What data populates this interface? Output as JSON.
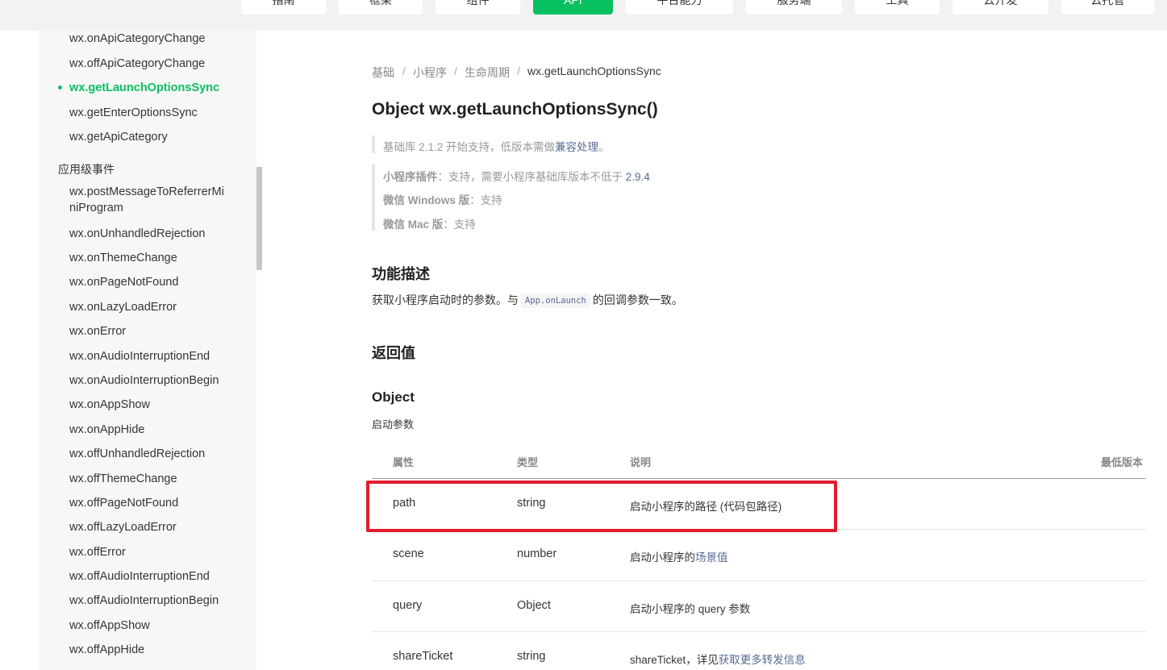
{
  "top_nav": {
    "tabs": [
      {
        "label": "指南",
        "active": false
      },
      {
        "label": "框架",
        "active": false
      },
      {
        "label": "组件",
        "active": false
      },
      {
        "label": "API",
        "active": true
      },
      {
        "label": "平台能力",
        "active": false
      },
      {
        "label": "服务端",
        "active": false
      },
      {
        "label": "工具",
        "active": false
      },
      {
        "label": "云开发",
        "active": false
      },
      {
        "label": "云托管",
        "active": false
      }
    ]
  },
  "sidebar": {
    "items_top": [
      {
        "label": "wx.onApiCategoryChange",
        "active": false
      },
      {
        "label": "wx.offApiCategoryChange",
        "active": false
      },
      {
        "label": "wx.getLaunchOptionsSync",
        "active": true
      },
      {
        "label": "wx.getEnterOptionsSync",
        "active": false
      },
      {
        "label": "wx.getApiCategory",
        "active": false
      }
    ],
    "group_title": "应用级事件",
    "group_items": [
      {
        "label_line1": "wx.postMessageToReferrerMi",
        "label_line2": "niProgram"
      },
      {
        "label": "wx.onUnhandledRejection"
      },
      {
        "label": "wx.onThemeChange"
      },
      {
        "label": "wx.onPageNotFound"
      },
      {
        "label": "wx.onLazyLoadError"
      },
      {
        "label": "wx.onError"
      },
      {
        "label": "wx.onAudioInterruptionEnd"
      },
      {
        "label": "wx.onAudioInterruptionBegin"
      },
      {
        "label": "wx.onAppShow"
      },
      {
        "label": "wx.onAppHide"
      },
      {
        "label": "wx.offUnhandledRejection"
      },
      {
        "label": "wx.offThemeChange"
      },
      {
        "label": "wx.offPageNotFound"
      },
      {
        "label": "wx.offLazyLoadError"
      },
      {
        "label": "wx.offError"
      },
      {
        "label": "wx.offAudioInterruptionEnd"
      },
      {
        "label": "wx.offAudioInterruptionBegin"
      },
      {
        "label": "wx.offAppShow"
      },
      {
        "label": "wx.offAppHide"
      }
    ]
  },
  "breadcrumb": {
    "items": [
      "基础",
      "小程序",
      "生命周期"
    ],
    "current": "wx.getLaunchOptionsSync",
    "separator": "/"
  },
  "page_title": "Object wx.getLaunchOptionsSync()",
  "support_note": {
    "prefix": "基础库 2.1.2 开始支持，低版本需做",
    "link": "兼容处理",
    "suffix": "。"
  },
  "compat": {
    "plugin_label": "小程序插件",
    "plugin_text": "：支持，需要小程序基础库版本不低于 ",
    "plugin_version": "2.9.4",
    "windows_label": "微信 Windows 版",
    "windows_text": "：支持",
    "mac_label": "微信 Mac 版",
    "mac_text": "：支持"
  },
  "section_desc": {
    "heading": "功能描述",
    "text_before": "获取小程序启动时的参数。与",
    "code": "App.onLaunch",
    "text_after": "的回调参数一致。"
  },
  "section_return": {
    "heading": "返回值",
    "object_heading": "Object",
    "object_desc": "启动参数"
  },
  "table": {
    "headers": {
      "prop": "属性",
      "type": "类型",
      "desc": "说明",
      "min_version": "最低版本"
    },
    "rows": [
      {
        "prop": "path",
        "type": "string",
        "desc": "启动小程序的路径 (代码包路径)",
        "highlighted": true
      },
      {
        "prop": "scene",
        "type": "number",
        "desc_text": "启动小程序的",
        "desc_link": "场景值"
      },
      {
        "prop": "query",
        "type": "Object",
        "desc": "启动小程序的 query 参数"
      },
      {
        "prop": "shareTicket",
        "type": "string",
        "desc_text": "shareTicket，详见",
        "desc_link": "获取更多转发信息"
      }
    ]
  },
  "colors": {
    "accent": "#07c160",
    "link": "#576b95",
    "highlight_box": "#e11d2b"
  }
}
